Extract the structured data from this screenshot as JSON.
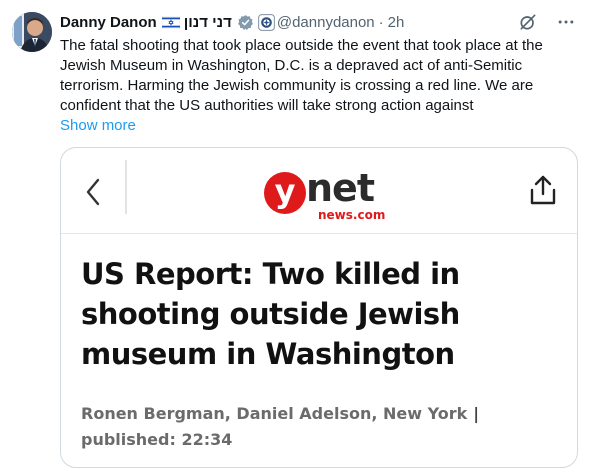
{
  "author": {
    "name": "Danny Danon",
    "hebrew_name": "דני דנון",
    "handle": "@dannydanon",
    "separator": "·",
    "time": "2h"
  },
  "tweet": {
    "text": "The fatal shooting that took place outside the event that took place at the Jewish Museum in Washington, D.C. is a depraved act of anti-Semitic terrorism. Harming the Jewish community is crossing a red line. We are confident that the US authorities will take strong action against",
    "show_more": "Show more"
  },
  "card": {
    "logo_letter": "y",
    "logo_word": "net",
    "logo_sub": "news.com",
    "headline": "US Report: Two killed in shooting outside Jewish museum in Washington",
    "byline": "Ronen Bergman, Daniel Adelson, New York",
    "byline_sep": "|",
    "published": "published: 22:34"
  },
  "colors": {
    "link": "#1d9bf0",
    "muted": "#536471",
    "brand_red": "#de1a1a",
    "verified": "#829aab"
  },
  "icons": [
    "israel-flag-icon",
    "verified-badge-icon",
    "affiliation-badge-icon",
    "grok-icon",
    "more-icon",
    "back-icon",
    "share-icon"
  ]
}
